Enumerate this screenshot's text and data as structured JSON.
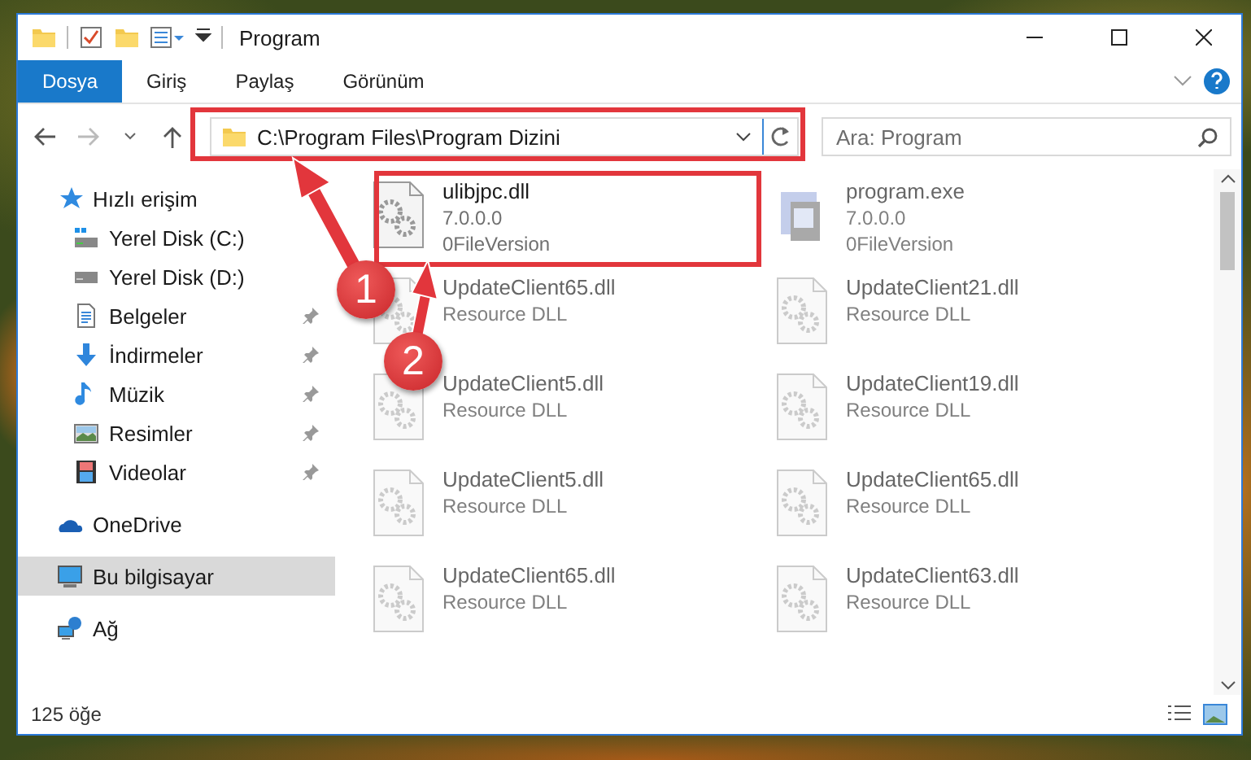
{
  "window": {
    "title": "Program"
  },
  "ribbon_tabs": [
    {
      "label": "Dosya",
      "selected": true
    },
    {
      "label": "Giriş",
      "selected": false
    },
    {
      "label": "Paylaş",
      "selected": false
    },
    {
      "label": "Görünüm",
      "selected": false
    }
  ],
  "address": {
    "path": "C:\\Program Files\\Program Dizini"
  },
  "search": {
    "placeholder": "Ara: Program"
  },
  "sidebar": {
    "items": [
      {
        "label": "Hızlı erişim",
        "kind": "quick",
        "selected": false,
        "children": [
          {
            "label": "Yerel Disk (C:)",
            "kind": "drive-c",
            "selected": false,
            "pinned": false
          },
          {
            "label": "Yerel Disk (D:)",
            "kind": "drive",
            "selected": false,
            "pinned": false
          },
          {
            "label": "Belgeler",
            "kind": "docs",
            "selected": false,
            "pinned": true
          },
          {
            "label": "İndirmeler",
            "kind": "downloads",
            "selected": false,
            "pinned": true
          },
          {
            "label": "Müzik",
            "kind": "music",
            "selected": false,
            "pinned": true
          },
          {
            "label": "Resimler",
            "kind": "pictures",
            "selected": false,
            "pinned": true
          },
          {
            "label": "Videolar",
            "kind": "videos",
            "selected": false,
            "pinned": true
          }
        ]
      },
      {
        "label": "OneDrive",
        "kind": "cloud",
        "selected": false
      },
      {
        "label": "Bu bilgisayar",
        "kind": "pc",
        "selected": true
      },
      {
        "label": "Ağ",
        "kind": "network",
        "selected": false
      }
    ]
  },
  "files": [
    {
      "name": "ulibjpc.dll",
      "details": [
        "7.0.0.0",
        "0FileVersion"
      ],
      "kind": "dll",
      "dimmed": false
    },
    {
      "name": "program.exe",
      "details": [
        "7.0.0.0",
        "0FileVersion"
      ],
      "kind": "exe",
      "dimmed": true
    },
    {
      "name": "UpdateClient65.dll",
      "details": [
        "Resource DLL"
      ],
      "kind": "dll",
      "dimmed": true
    },
    {
      "name": "UpdateClient21.dll",
      "details": [
        "Resource DLL"
      ],
      "kind": "dll",
      "dimmed": true
    },
    {
      "name": "UpdateClient5.dll",
      "details": [
        "Resource DLL"
      ],
      "kind": "dll",
      "dimmed": true
    },
    {
      "name": "UpdateClient19.dll",
      "details": [
        "Resource DLL"
      ],
      "kind": "dll",
      "dimmed": true
    },
    {
      "name": "UpdateClient5.dll",
      "details": [
        "Resource DLL"
      ],
      "kind": "dll",
      "dimmed": true
    },
    {
      "name": "UpdateClient65.dll",
      "details": [
        "Resource DLL"
      ],
      "kind": "dll",
      "dimmed": true
    },
    {
      "name": "UpdateClient65.dll",
      "details": [
        "Resource DLL"
      ],
      "kind": "dll",
      "dimmed": true
    },
    {
      "name": "UpdateClient63.dll",
      "details": [
        "Resource DLL"
      ],
      "kind": "dll",
      "dimmed": true
    }
  ],
  "status_bar": {
    "count": "125 öğe"
  },
  "annotations": [
    {
      "number": "1"
    },
    {
      "number": "2"
    }
  ]
}
